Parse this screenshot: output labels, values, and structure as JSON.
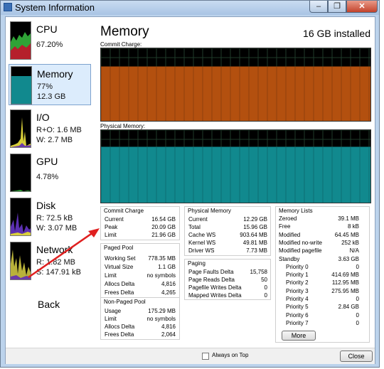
{
  "window": {
    "title": "System Information",
    "controls": [
      "minimize",
      "restore",
      "close"
    ]
  },
  "sidebar": {
    "items": [
      {
        "key": "cpu",
        "label": "CPU",
        "line1": "67.20%",
        "line2": ""
      },
      {
        "key": "memory",
        "label": "Memory",
        "line1": "77%",
        "line2": "12.3 GB",
        "selected": true
      },
      {
        "key": "io",
        "label": "I/O",
        "line1": "R+O: 1.6 MB",
        "line2": "W: 2.7 MB"
      },
      {
        "key": "gpu",
        "label": "GPU",
        "line1": "4.78%",
        "line2": ""
      },
      {
        "key": "disk",
        "label": "Disk",
        "line1": "R: 72.5 kB",
        "line2": "W: 3.07 MB"
      },
      {
        "key": "network",
        "label": "Network",
        "line1": "R: 1.82 MB",
        "line2": "S: 147.91 kB"
      }
    ]
  },
  "header": {
    "title": "Memory",
    "installed": "16 GB installed"
  },
  "graphs": {
    "commit_label": "Commit Charge:",
    "physical_label": "Physical Memory:",
    "commit_fill_fraction": 0.75,
    "physical_fill_fraction": 0.77,
    "colors": {
      "commit": "#b3500f",
      "physical": "#11898e",
      "grid": "#1f3a2a"
    }
  },
  "commit_charge": {
    "title": "Commit Charge",
    "rows": [
      {
        "k": "Current",
        "v": "16.54 GB"
      },
      {
        "k": "Peak",
        "v": "20.09 GB"
      },
      {
        "k": "Limit",
        "v": "21.96 GB"
      }
    ]
  },
  "physical_memory": {
    "title": "Physical Memory",
    "rows": [
      {
        "k": "Current",
        "v": "12.29 GB"
      },
      {
        "k": "Total",
        "v": "15.96 GB"
      },
      {
        "k": "Cache WS",
        "v": "903.64 MB"
      },
      {
        "k": "Kernel WS",
        "v": "49.81 MB"
      },
      {
        "k": "Driver WS",
        "v": "7.73 MB"
      }
    ]
  },
  "paged_pool": {
    "title": "Paged Pool",
    "rows": [
      {
        "k": "Working Set",
        "v": "778.35 MB"
      },
      {
        "k": "Virtual Size",
        "v": "1.1 GB"
      },
      {
        "k": "Limit",
        "v": "no symbols"
      },
      {
        "k": "Allocs Delta",
        "v": "4,816"
      },
      {
        "k": "Frees Delta",
        "v": "4,265"
      }
    ]
  },
  "paging": {
    "title": "Paging",
    "rows": [
      {
        "k": "Page Faults Delta",
        "v": "15,758"
      },
      {
        "k": "Page Reads Delta",
        "v": "50"
      },
      {
        "k": "Pagefile Writes Delta",
        "v": "0"
      },
      {
        "k": "Mapped Writes Delta",
        "v": "0"
      }
    ]
  },
  "nonpaged_pool": {
    "title": "Non-Paged Pool",
    "rows": [
      {
        "k": "Usage",
        "v": "175.29 MB"
      },
      {
        "k": "Limit",
        "v": "no symbols"
      },
      {
        "k": "Allocs Delta",
        "v": "4,816"
      },
      {
        "k": "Frees Delta",
        "v": "2,064"
      }
    ]
  },
  "memory_lists": {
    "title": "Memory Lists",
    "rows": [
      {
        "k": "Zeroed",
        "v": "39.1 MB"
      },
      {
        "k": "Free",
        "v": "8 kB"
      },
      {
        "k": "Modified",
        "v": "64.45 MB"
      },
      {
        "k": "Modified no-write",
        "v": "252 kB"
      },
      {
        "k": "Modified pagefile",
        "v": "N/A"
      },
      {
        "k": "Standby",
        "v": "3.63 GB"
      },
      {
        "k": "Priority 0",
        "v": "0",
        "indent": true
      },
      {
        "k": "Priority 1",
        "v": "414.69 MB",
        "indent": true
      },
      {
        "k": "Priority 2",
        "v": "112.95 MB",
        "indent": true
      },
      {
        "k": "Priority 3",
        "v": "275.95 MB",
        "indent": true
      },
      {
        "k": "Priority 4",
        "v": "0",
        "indent": true
      },
      {
        "k": "Priority 5",
        "v": "2.84 GB",
        "indent": true
      },
      {
        "k": "Priority 6",
        "v": "0",
        "indent": true
      },
      {
        "k": "Priority 7",
        "v": "0",
        "indent": true
      }
    ],
    "more_label": "More"
  },
  "footer": {
    "always_on_top_label": "Always on Top",
    "always_on_top_checked": false,
    "close_label": "Close"
  },
  "annotation": {
    "label": "Back",
    "arrow_color": "#e02020"
  }
}
